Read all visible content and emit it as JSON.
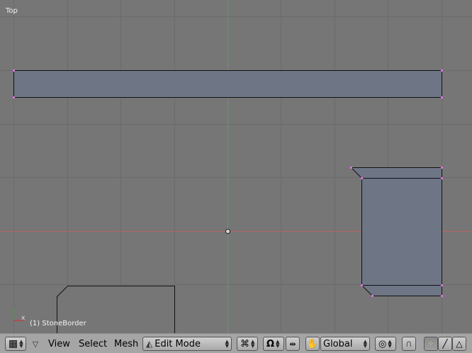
{
  "viewport": {
    "view_name": "Top",
    "object_label": "(1) StoneBorder",
    "axis_label": "x"
  },
  "header": {
    "menus": [
      "View",
      "Select",
      "Mesh"
    ],
    "mode": "Edit Mode",
    "orientation": "Global"
  },
  "colors": {
    "grid_bg": "#767676",
    "grid_line": "#6a6a6a",
    "x_axis": "#b36464",
    "y_axis": "#55a055",
    "mesh_fill": "#6e7585",
    "vertex": "#e070e0"
  }
}
